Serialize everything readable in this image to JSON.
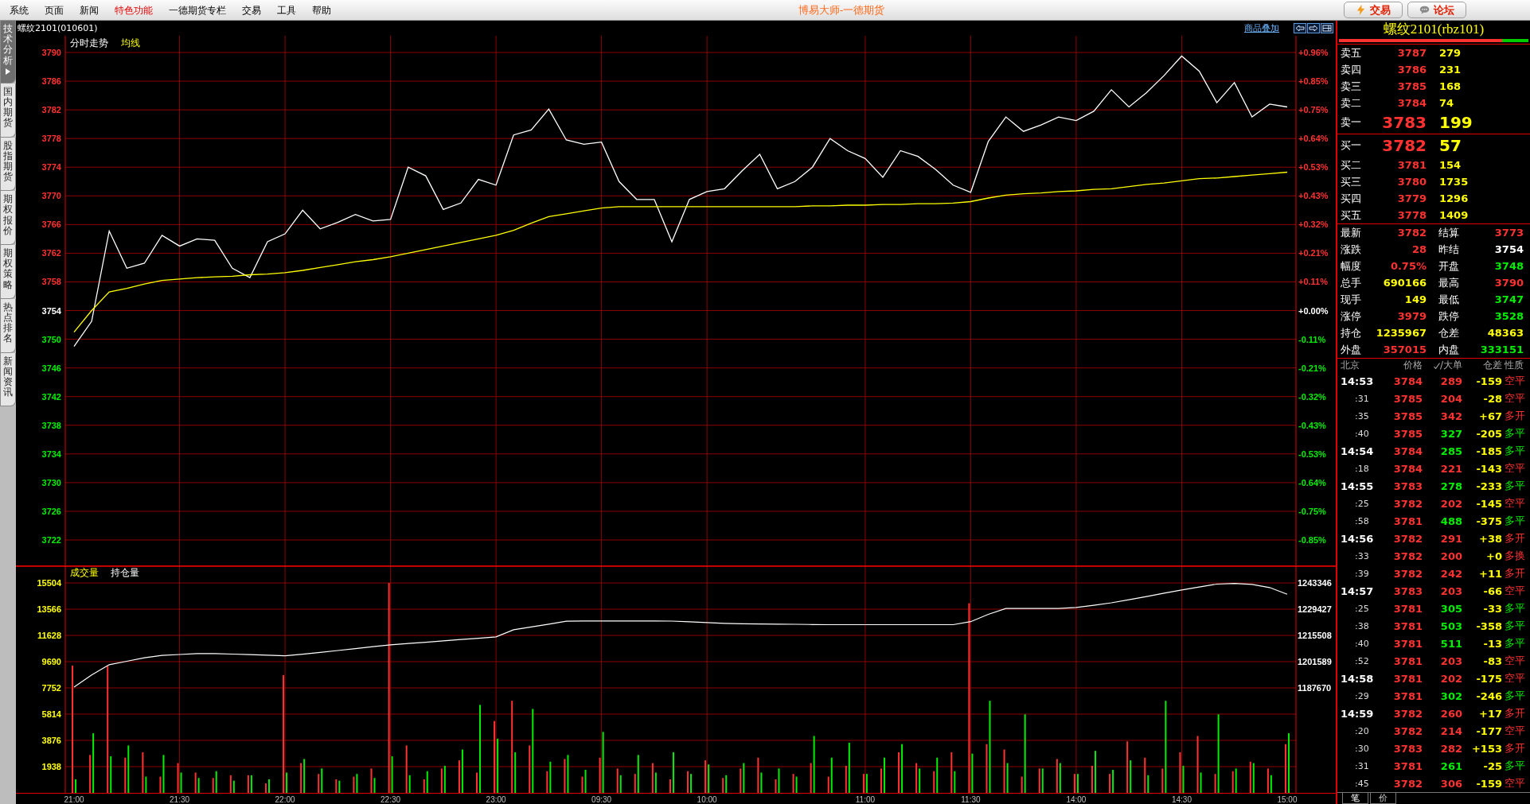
{
  "menu": {
    "items": [
      {
        "label": "系统",
        "highlighted": false
      },
      {
        "label": "页面",
        "highlighted": false
      },
      {
        "label": "新闻",
        "highlighted": false
      },
      {
        "label": "特色功能",
        "highlighted": true
      },
      {
        "label": "一德期货专栏",
        "highlighted": false
      },
      {
        "label": "交易",
        "highlighted": false
      },
      {
        "label": "工具",
        "highlighted": false
      },
      {
        "label": "帮助",
        "highlighted": false
      }
    ]
  },
  "app_title": "博易大师-一德期货",
  "title_buttons": [
    {
      "label": "交易",
      "kind": "trade"
    },
    {
      "label": "论坛",
      "kind": "forum"
    }
  ],
  "side_tabs": [
    {
      "label": "技术分析",
      "selected": true
    },
    {
      "label": "国内期货",
      "selected": false
    },
    {
      "label": "股指期货",
      "selected": false
    },
    {
      "label": "期权报价",
      "selected": false
    },
    {
      "label": "期权策略",
      "selected": false
    },
    {
      "label": "热点排名",
      "selected": false
    },
    {
      "label": "新闻资讯",
      "selected": false
    }
  ],
  "chart_header": {
    "symbol": "螺纹2101(010601)",
    "overlay_link": "商品叠加"
  },
  "price_chart": {
    "right_axis": [
      {
        "label": "+0.96%",
        "color": "#ff3232"
      },
      {
        "label": "+0.85%",
        "color": "#ff3232"
      },
      {
        "label": "+0.75%",
        "color": "#ff3232"
      },
      {
        "label": "+0.64%",
        "color": "#ff3232"
      },
      {
        "label": "+0.53%",
        "color": "#ff3232"
      },
      {
        "label": "+0.43%",
        "color": "#ff3232"
      },
      {
        "label": "+0.32%",
        "color": "#ff3232"
      },
      {
        "label": "+0.21%",
        "color": "#ff3232"
      },
      {
        "label": "+0.11%",
        "color": "#ff3232"
      },
      {
        "label": "+0.00%",
        "color": "#ffffff"
      },
      {
        "label": "-0.11%",
        "color": "#00ee00"
      },
      {
        "label": "-0.21%",
        "color": "#00ee00"
      },
      {
        "label": "-0.32%",
        "color": "#00ee00"
      },
      {
        "label": "-0.43%",
        "color": "#00ee00"
      },
      {
        "label": "-0.53%",
        "color": "#00ee00"
      },
      {
        "label": "-0.64%",
        "color": "#00ee00"
      },
      {
        "label": "-0.75%",
        "color": "#00ee00"
      },
      {
        "label": "-0.85%",
        "color": "#00ee00"
      }
    ],
    "chart_data": {
      "type": "line",
      "grid": true,
      "ylim": [
        3718.45,
        3792.33
      ],
      "categories": [
        null,
        null,
        null,
        null,
        null,
        null,
        null,
        null,
        null,
        null,
        null,
        null,
        null,
        null,
        null,
        null,
        null,
        null,
        null,
        null,
        null,
        null,
        null,
        null,
        null,
        null,
        null,
        null,
        null,
        null,
        null,
        null,
        null,
        null,
        null,
        null,
        null,
        null,
        null,
        null,
        null,
        null,
        null,
        null,
        null,
        null,
        null,
        null,
        null,
        null,
        null,
        null,
        null,
        null,
        null,
        null,
        null,
        null,
        null,
        null,
        null,
        null,
        null,
        null,
        null,
        null,
        null,
        null,
        null,
        null
      ],
      "yticks": [
        3790,
        3786,
        3782,
        3778,
        3774,
        3770,
        3766,
        3762,
        3758,
        3754,
        3750,
        3746,
        3742,
        3738,
        3734,
        3730,
        3726,
        3722
      ],
      "series": [
        {
          "name": "分时走势",
          "color": "#ffffff",
          "values": [
            3749.0,
            3752.5,
            3765.1,
            3759.9,
            3760.6,
            3764.5,
            3763.0,
            3764.0,
            3763.8,
            3759.9,
            3758.6,
            3763.6,
            3764.7,
            3768.0,
            3765.4,
            3766.3,
            3767.4,
            3766.5,
            3766.7,
            3774.0,
            3772.8,
            3768.1,
            3769.0,
            3772.3,
            3771.5,
            3778.5,
            3779.2,
            3782.1,
            3777.8,
            3777.2,
            3777.5,
            3772.0,
            3769.5,
            3769.5,
            3763.6,
            3769.5,
            3770.6,
            3771.0,
            3773.5,
            3775.8,
            3771.0,
            3772.0,
            3774.0,
            3778.0,
            3776.3,
            3775.2,
            3772.6,
            3776.3,
            3775.5,
            3773.7,
            3771.5,
            3770.5,
            3777.6,
            3781.0,
            3779.0,
            3779.9,
            3781.0,
            3780.5,
            3781.8,
            3784.8,
            3782.4,
            3784.4,
            3786.8,
            3789.5,
            3787.4,
            3783.0,
            3785.8,
            3781.0,
            3782.8,
            3782.4
          ]
        },
        {
          "name": "均线",
          "color": "#ffff00",
          "values": [
            3751.0,
            3754.0,
            3756.6,
            3757.1,
            3757.7,
            3758.2,
            3758.4,
            3758.6,
            3758.7,
            3758.8,
            3759.0,
            3759.1,
            3759.3,
            3759.6,
            3760.0,
            3760.4,
            3760.8,
            3761.1,
            3761.5,
            3762.0,
            3762.5,
            3763.0,
            3763.5,
            3764.0,
            3764.5,
            3765.2,
            3766.2,
            3767.1,
            3767.5,
            3767.9,
            3768.3,
            3768.5,
            3768.5,
            3768.5,
            3768.5,
            3768.5,
            3768.5,
            3768.5,
            3768.5,
            3768.5,
            3768.5,
            3768.5,
            3768.6,
            3768.6,
            3768.7,
            3768.7,
            3768.8,
            3768.8,
            3768.9,
            3768.9,
            3769.0,
            3769.2,
            3769.7,
            3770.1,
            3770.3,
            3770.4,
            3770.6,
            3770.7,
            3770.9,
            3771.0,
            3771.3,
            3771.6,
            3771.8,
            3772.1,
            3772.4,
            3772.5,
            3772.7,
            3772.9,
            3773.1,
            3773.3
          ]
        }
      ]
    }
  },
  "volume_chart": {
    "chart_data": {
      "type": "bar",
      "grid": true,
      "ylim": [
        0,
        16796
      ],
      "categories": [
        "21:00",
        null,
        null,
        null,
        null,
        null,
        "21:30",
        null,
        null,
        null,
        null,
        null,
        "22:00",
        null,
        null,
        null,
        null,
        null,
        "22:30",
        null,
        null,
        null,
        null,
        null,
        "23:00",
        null,
        null,
        null,
        null,
        null,
        "09:30",
        null,
        null,
        null,
        null,
        null,
        "10:00",
        null,
        null,
        null,
        null,
        null,
        null,
        null,
        null,
        "11:00",
        null,
        null,
        null,
        null,
        null,
        "11:30",
        null,
        null,
        null,
        null,
        null,
        "14:00",
        null,
        null,
        null,
        null,
        null,
        "14:30",
        null,
        null,
        null,
        null,
        null,
        "15:00"
      ],
      "yticks": [
        15504,
        13566,
        11628,
        9690,
        7752,
        5814,
        3876,
        1938
      ],
      "series": [
        {
          "color": "#ff3232",
          "values": [
            9400,
            2800,
            9400,
            2600,
            3000,
            1200,
            2200,
            1500,
            1100,
            1300,
            1300,
            700,
            8700,
            2200,
            1400,
            1000,
            1200,
            1800,
            15500,
            3500,
            1000,
            1800,
            2400,
            1500,
            5300,
            6800,
            3500,
            1600,
            2500,
            1200,
            2600,
            1800,
            1400,
            2200,
            1000,
            1600,
            2400,
            1100,
            1800,
            2600,
            1000,
            1400,
            2200,
            1200,
            2000,
            1400,
            1800,
            3000,
            2200,
            1600,
            3000,
            14000,
            3600,
            3200,
            1200,
            1800,
            2500,
            1400,
            2000,
            1400,
            3800,
            2600,
            1800,
            3000,
            4200,
            1400,
            1600,
            2300,
            1800,
            3600
          ]
        },
        {
          "color": "#00ee00",
          "values": [
            1000,
            4400,
            2700,
            3500,
            1200,
            2800,
            1500,
            1100,
            1600,
            900,
            1300,
            1000,
            1500,
            2500,
            1800,
            900,
            1400,
            1100,
            2700,
            1300,
            1600,
            2000,
            3200,
            6500,
            4000,
            3000,
            6200,
            2300,
            2800,
            1700,
            4500,
            1300,
            2800,
            1500,
            3000,
            1400,
            2100,
            1300,
            2200,
            1500,
            1800,
            1200,
            4200,
            2600,
            3700,
            1400,
            2600,
            3600,
            1800,
            2600,
            1600,
            2900,
            6800,
            2200,
            5800,
            1800,
            2200,
            1400,
            3100,
            1700,
            2400,
            1300,
            6800,
            2000,
            1500,
            5800,
            1800,
            2200,
            1300,
            4400
          ]
        }
      ]
    },
    "legend_label": "成交量"
  },
  "open_interest_chart": {
    "chart_data": {
      "type": "line",
      "ylim": [
        1131994,
        1252625
      ],
      "categories": [
        null,
        null,
        null,
        null,
        null,
        null,
        null,
        null,
        null,
        null,
        null,
        null,
        null,
        null,
        null,
        null,
        null,
        null,
        null,
        null,
        null,
        null,
        null,
        null,
        null,
        null,
        null,
        null,
        null,
        null,
        null,
        null,
        null,
        null,
        null,
        null,
        null,
        null,
        null,
        null,
        null,
        null,
        null,
        null,
        null,
        null,
        null,
        null,
        null,
        null,
        null,
        null,
        null,
        null,
        null,
        null,
        null,
        null,
        null,
        null,
        null,
        null,
        null,
        null,
        null,
        null,
        null,
        null,
        null,
        null
      ],
      "yticks": [
        1243346,
        1229427,
        1215508,
        1201589,
        1187670
      ],
      "series": [
        {
          "name": "持仓量",
          "color": "#ffffff",
          "values": [
            1188100,
            1194500,
            1200000,
            1201800,
            1203600,
            1204900,
            1205400,
            1205900,
            1205900,
            1205600,
            1205300,
            1205000,
            1204700,
            1205500,
            1206500,
            1207500,
            1208500,
            1209500,
            1210500,
            1211200,
            1211900,
            1212600,
            1213300,
            1214000,
            1214700,
            1218500,
            1220000,
            1221500,
            1223000,
            1223200,
            1223200,
            1223200,
            1223200,
            1223200,
            1223100,
            1222700,
            1222300,
            1221900,
            1221700,
            1221600,
            1221500,
            1221400,
            1221300,
            1221200,
            1221200,
            1221200,
            1221200,
            1221200,
            1221200,
            1221200,
            1221200,
            1222800,
            1226700,
            1229800,
            1229800,
            1229800,
            1229800,
            1230300,
            1231500,
            1232800,
            1234400,
            1236100,
            1237900,
            1239600,
            1241200,
            1242700,
            1243100,
            1242600,
            1240900,
            1237300
          ]
        }
      ]
    }
  },
  "quote": {
    "title": "螺纹2101(rbz101)",
    "buy_sell_bar": {
      "level": 0.86
    },
    "asks": [
      {
        "label": "卖五",
        "price": "3787",
        "volume": "279",
        "best": false
      },
      {
        "label": "卖四",
        "price": "3786",
        "volume": "231",
        "best": false
      },
      {
        "label": "卖三",
        "price": "3785",
        "volume": "168",
        "best": false
      },
      {
        "label": "卖二",
        "price": "3784",
        "volume": "74",
        "best": false
      },
      {
        "label": "卖一",
        "price": "3783",
        "volume": "199",
        "best": true
      }
    ],
    "bids": [
      {
        "label": "买一",
        "price": "3782",
        "volume": "57",
        "best": true
      },
      {
        "label": "买二",
        "price": "3781",
        "volume": "154",
        "best": false
      },
      {
        "label": "买三",
        "price": "3780",
        "volume": "1735",
        "best": false
      },
      {
        "label": "买四",
        "price": "3779",
        "volume": "1296",
        "best": false
      },
      {
        "label": "买五",
        "price": "3778",
        "volume": "1409",
        "best": false
      }
    ],
    "stats": [
      {
        "label": "最新",
        "value": "3782",
        "color": "#ff3232"
      },
      {
        "label": "结算",
        "value": "3773",
        "color": "#ff3232"
      },
      {
        "label": "涨跌",
        "value": "28",
        "color": "#ff3232"
      },
      {
        "label": "昨结",
        "value": "3754",
        "color": "#ffffff"
      },
      {
        "label": "幅度",
        "value": "0.75%",
        "color": "#ff3232"
      },
      {
        "label": "开盘",
        "value": "3748",
        "color": "#00ee00"
      },
      {
        "label": "总手",
        "value": "690166",
        "color": "#ffff00"
      },
      {
        "label": "最高",
        "value": "3790",
        "color": "#ff3232"
      },
      {
        "label": "现手",
        "value": "149",
        "color": "#ffff00"
      },
      {
        "label": "最低",
        "value": "3747",
        "color": "#00ee00"
      },
      {
        "label": "涨停",
        "value": "3979",
        "color": "#ff3232"
      },
      {
        "label": "跌停",
        "value": "3528",
        "color": "#00ee00"
      },
      {
        "label": "持仓",
        "value": "1235967",
        "color": "#ffff00"
      },
      {
        "label": "仓差",
        "value": "48363",
        "color": "#ffff00"
      },
      {
        "label": "外盘",
        "value": "357015",
        "color": "#ff3232"
      },
      {
        "label": "内盘",
        "value": "333151",
        "color": "#00ee00"
      }
    ]
  },
  "trades": {
    "columns": [
      "北京",
      "价格",
      "/大单",
      "仓差",
      "性质"
    ],
    "rows": [
      {
        "time": "14:53",
        "kind": "minute",
        "price": "3784",
        "volume": "289",
        "oi_change": "-159",
        "nature": "空平",
        "color": "#ff3232"
      },
      {
        "time": ":31",
        "kind": "second",
        "price": "3785",
        "volume": "204",
        "oi_change": "-28",
        "nature": "空平",
        "color": "#ff3232"
      },
      {
        "time": ":35",
        "kind": "second",
        "price": "3785",
        "volume": "342",
        "oi_change": "+67",
        "nature": "多开",
        "color": "#ff3232"
      },
      {
        "time": ":40",
        "kind": "second",
        "price": "3785",
        "volume": "327",
        "oi_change": "-205",
        "nature": "多平",
        "color": "#00ee00"
      },
      {
        "time": "14:54",
        "kind": "minute",
        "price": "3784",
        "volume": "285",
        "oi_change": "-185",
        "nature": "多平",
        "color": "#00ee00"
      },
      {
        "time": ":18",
        "kind": "second",
        "price": "3784",
        "volume": "221",
        "oi_change": "-143",
        "nature": "空平",
        "color": "#ff3232"
      },
      {
        "time": "14:55",
        "kind": "minute",
        "price": "3783",
        "volume": "278",
        "oi_change": "-233",
        "nature": "多平",
        "color": "#00ee00"
      },
      {
        "time": ":25",
        "kind": "second",
        "price": "3782",
        "volume": "202",
        "oi_change": "-145",
        "nature": "空平",
        "color": "#ff3232"
      },
      {
        "time": ":58",
        "kind": "second",
        "price": "3781",
        "volume": "488",
        "oi_change": "-375",
        "nature": "多平",
        "color": "#00ee00"
      },
      {
        "time": "14:56",
        "kind": "minute",
        "price": "3782",
        "volume": "291",
        "oi_change": "+38",
        "nature": "多开",
        "color": "#ff3232"
      },
      {
        "time": ":33",
        "kind": "second",
        "price": "3782",
        "volume": "200",
        "oi_change": "+0",
        "nature": "多换",
        "color": "#ff3232"
      },
      {
        "time": ":39",
        "kind": "second",
        "price": "3782",
        "volume": "242",
        "oi_change": "+11",
        "nature": "多开",
        "color": "#ff3232"
      },
      {
        "time": "14:57",
        "kind": "minute",
        "price": "3783",
        "volume": "203",
        "oi_change": "-66",
        "nature": "空平",
        "color": "#ff3232"
      },
      {
        "time": ":25",
        "kind": "second",
        "price": "3781",
        "volume": "305",
        "oi_change": "-33",
        "nature": "多平",
        "color": "#00ee00"
      },
      {
        "time": ":38",
        "kind": "second",
        "price": "3781",
        "volume": "503",
        "oi_change": "-358",
        "nature": "多平",
        "color": "#00ee00"
      },
      {
        "time": ":40",
        "kind": "second",
        "price": "3781",
        "volume": "511",
        "oi_change": "-13",
        "nature": "多平",
        "color": "#00ee00"
      },
      {
        "time": ":52",
        "kind": "second",
        "price": "3781",
        "volume": "203",
        "oi_change": "-83",
        "nature": "空平",
        "color": "#ff3232"
      },
      {
        "time": "14:58",
        "kind": "minute",
        "price": "3781",
        "volume": "202",
        "oi_change": "-175",
        "nature": "空平",
        "color": "#ff3232"
      },
      {
        "time": ":29",
        "kind": "second",
        "price": "3781",
        "volume": "302",
        "oi_change": "-246",
        "nature": "多平",
        "color": "#00ee00"
      },
      {
        "time": "14:59",
        "kind": "minute",
        "price": "3782",
        "volume": "260",
        "oi_change": "+17",
        "nature": "多开",
        "color": "#ff3232"
      },
      {
        "time": ":20",
        "kind": "second",
        "price": "3782",
        "volume": "214",
        "oi_change": "-177",
        "nature": "空平",
        "color": "#ff3232"
      },
      {
        "time": ":30",
        "kind": "second",
        "price": "3783",
        "volume": "282",
        "oi_change": "+153",
        "nature": "多开",
        "color": "#ff3232"
      },
      {
        "time": ":31",
        "kind": "second",
        "price": "3781",
        "volume": "261",
        "oi_change": "-25",
        "nature": "多平",
        "color": "#00ee00"
      },
      {
        "time": ":45",
        "kind": "second",
        "price": "3782",
        "volume": "306",
        "oi_change": "-159",
        "nature": "空平",
        "color": "#ff3232"
      }
    ]
  },
  "bottom_tabs": [
    {
      "label": "笔",
      "selected": true
    },
    {
      "label": "价",
      "selected": false
    }
  ]
}
